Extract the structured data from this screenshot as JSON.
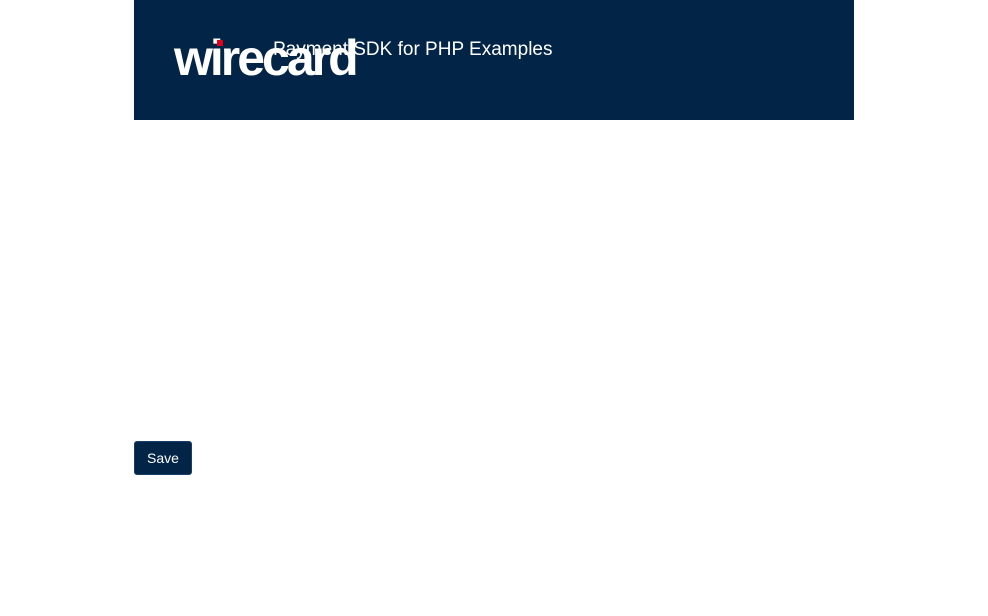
{
  "header": {
    "logo_text": "wirecard",
    "title": "Payment SDK for PHP Examples",
    "background_color": "#022447",
    "logo_accent_color": "#e2001a"
  },
  "form": {
    "save_label": "Save"
  }
}
